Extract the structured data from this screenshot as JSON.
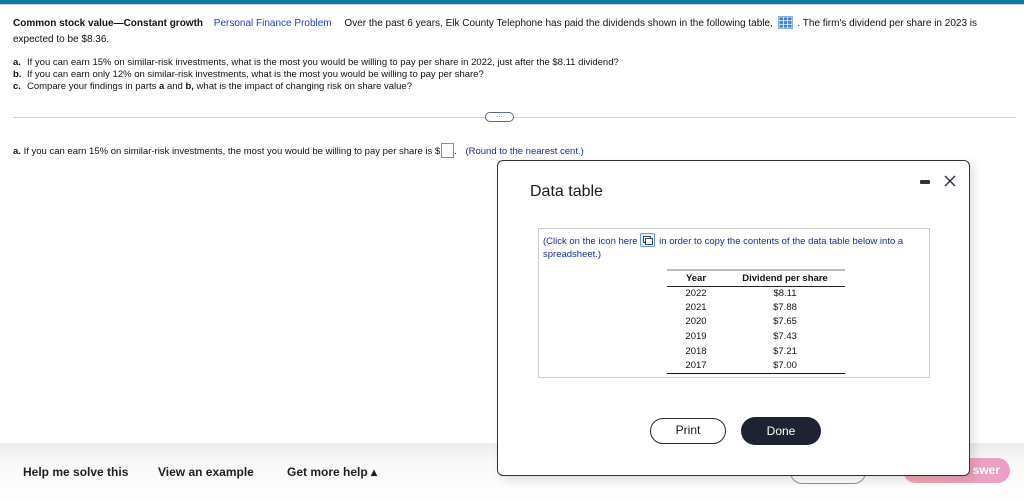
{
  "header": {
    "accent_color": "#117a99"
  },
  "problem": {
    "title": "Common stock value—Constant growth",
    "category_link": "Personal Finance Problem",
    "text_before_icon": "Over the past 6 years, Elk County Telephone has paid the dividends shown in the following table,",
    "table_icon": "table-grid-icon",
    "text_after_icon": ". The firm's dividend per share in 2023 is expected to be $8.36."
  },
  "parts": [
    {
      "label": "a.",
      "text": "If you can earn 15% on similar-risk investments, what is the most you would be willing to pay per share in 2022, just after the $8.11 dividend?"
    },
    {
      "label": "b.",
      "text": "If you can earn only 12% on similar-risk investments, what is the most you would be willing to pay per share?"
    },
    {
      "label": "c.",
      "text_before": "Compare your findings in parts ",
      "bold1": "a",
      "text_mid": " and ",
      "bold2": "b,",
      "text_after": " what is the impact of changing risk on share value?"
    }
  ],
  "more_pill": "…",
  "answer": {
    "label": "a.",
    "text": "If you can earn 15% on similar-risk investments, the most you would be willing to pay per share is $",
    "input_value": "",
    "after_input": ".",
    "hint": "(Round to the nearest cent.)"
  },
  "modal": {
    "title": "Data table",
    "copy_note_before": "(Click on the icon here",
    "copy_note_after": " in order to copy the contents of the data table below into a spreadsheet.)",
    "table": {
      "headers": [
        "Year",
        "Dividend per share"
      ],
      "rows": [
        [
          "2022",
          "$8.11"
        ],
        [
          "2021",
          "$7.88"
        ],
        [
          "2020",
          "$7.65"
        ],
        [
          "2019",
          "$7.43"
        ],
        [
          "2018",
          "$7.21"
        ],
        [
          "2017",
          "$7.00"
        ]
      ]
    },
    "print_label": "Print",
    "done_label": "Done"
  },
  "footer": {
    "help_me_solve": "Help me solve this",
    "view_example": "View an example",
    "get_more_help": "Get more help ▴",
    "check_answer_visible": "swer"
  }
}
